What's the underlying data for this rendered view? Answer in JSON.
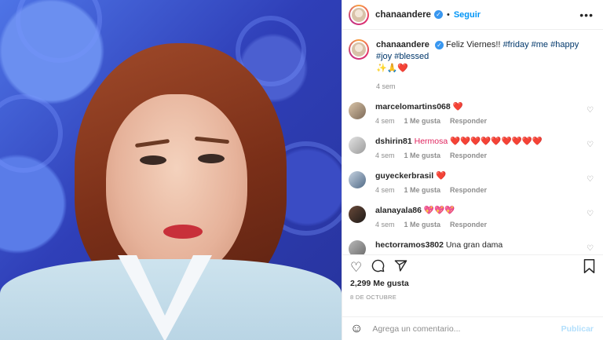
{
  "post": {
    "username": "chanaandere",
    "follow_label": "Seguir",
    "more_icon": "•••",
    "caption": {
      "username": "chanaandere",
      "text": "Feliz Viernes!!",
      "hashtags": [
        "#friday",
        "#me",
        "#happy",
        "#joy",
        "#blessed"
      ],
      "emojis": "✨🙏❤️",
      "time": "4 sem"
    },
    "comments": [
      {
        "username": "marcelomartins068",
        "text": "❤️",
        "time": "4 sem",
        "likes": "1 Me gusta",
        "reply": "Responder"
      },
      {
        "username": "dshirin81",
        "text": "Hermosa ❤️❤️❤️❤️❤️❤️❤️❤️❤️",
        "time": "4 sem",
        "likes": "1 Me gusta",
        "reply": "Responder"
      },
      {
        "username": "guyeckerbrasil",
        "text": "❤️",
        "time": "4 sem",
        "likes": "1 Me gusta",
        "reply": "Responder"
      },
      {
        "username": "alanayala86",
        "text": "💖💖💖",
        "time": "4 sem",
        "likes": "1 Me gusta",
        "reply": "Responder"
      },
      {
        "username": "hectorramos3802",
        "text": "Una gran dama",
        "time": "",
        "likes": "",
        "reply": ""
      }
    ],
    "likes_count": "2,299 Me gusta",
    "date": "8 DE OCTUBRE",
    "comment_placeholder": "Agrega un comentario...",
    "publish_label": "Publicar"
  },
  "colors": {
    "link": "#0095f6",
    "publish_disabled": "#b2dffc",
    "hashtag": "#00376b",
    "muted": "#8e8e8e"
  },
  "icons": [
    "heart-icon",
    "comment-icon",
    "share-icon",
    "bookmark-icon",
    "emoji-icon",
    "verified-badge-icon",
    "more-options-icon"
  ]
}
